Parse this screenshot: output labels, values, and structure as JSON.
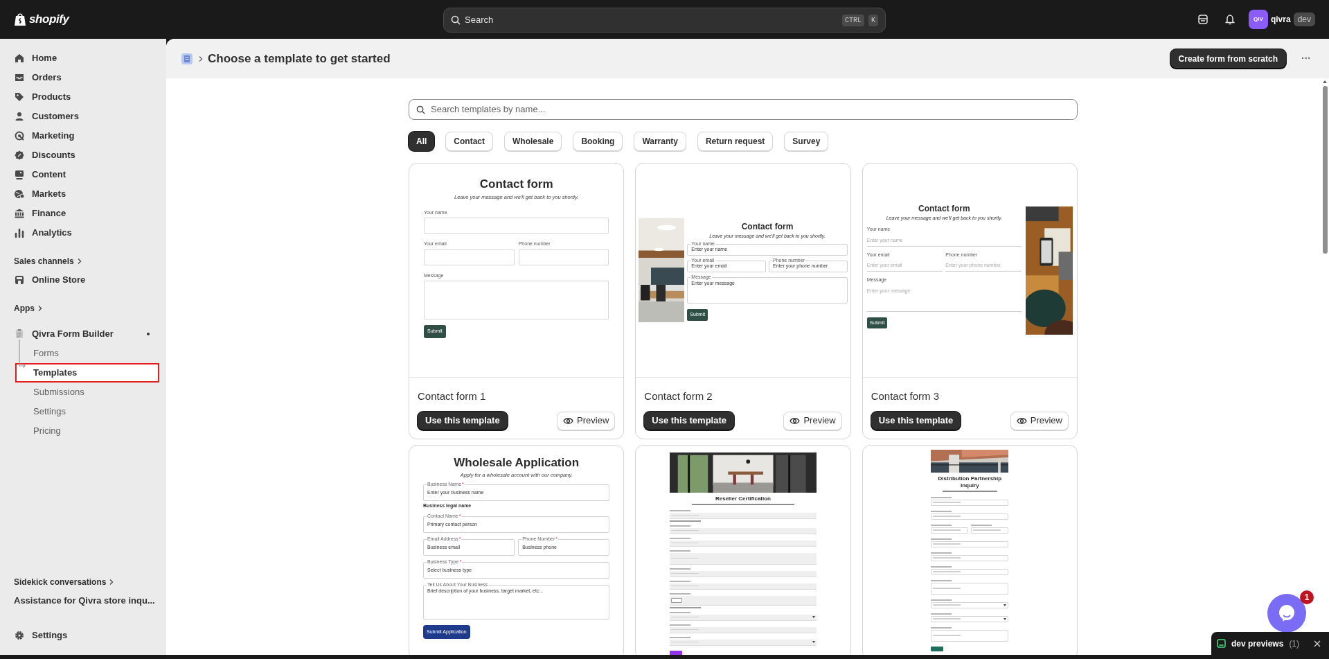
{
  "topbar": {
    "logo": "shopify",
    "search": {
      "placeholder": "Search",
      "keys": [
        "CTRL",
        "K"
      ]
    },
    "account": {
      "initials": "QIV",
      "store": "qivra",
      "badge": "dev"
    }
  },
  "sidebar": {
    "items": [
      {
        "label": "Home",
        "selected": false
      },
      {
        "label": "Orders",
        "selected": false
      },
      {
        "label": "Products",
        "selected": false
      },
      {
        "label": "Customers",
        "selected": false
      },
      {
        "label": "Marketing",
        "selected": false
      },
      {
        "label": "Discounts",
        "selected": false
      },
      {
        "label": "Content",
        "selected": false
      },
      {
        "label": "Markets",
        "selected": false
      },
      {
        "label": "Finance",
        "selected": false
      },
      {
        "label": "Analytics",
        "selected": false
      }
    ],
    "sales_channels": {
      "heading": "Sales channels",
      "items": [
        {
          "label": "Online Store",
          "selected": false
        }
      ]
    },
    "apps": {
      "heading": "Apps",
      "app": {
        "label": "Qivra Form Builder",
        "dot": true,
        "children": [
          {
            "label": "Forms",
            "selected": false
          },
          {
            "label": "Templates",
            "selected": true
          },
          {
            "label": "Submissions",
            "selected": false
          },
          {
            "label": "Settings",
            "selected": false
          },
          {
            "label": "Pricing",
            "selected": false
          }
        ]
      }
    },
    "sidekick": {
      "heading": "Sidekick conversations",
      "items": [
        "Assistance for Qivra store inqu..."
      ]
    },
    "footer_item": {
      "label": "Settings"
    }
  },
  "header": {
    "title": "Choose a template to get started",
    "primary_button": "Create form from scratch",
    "more": "···"
  },
  "search": {
    "placeholder": "Search templates by name..."
  },
  "filters": [
    {
      "label": "All",
      "selected": true
    },
    {
      "label": "Contact",
      "selected": false
    },
    {
      "label": "Wholesale",
      "selected": false
    },
    {
      "label": "Booking",
      "selected": false
    },
    {
      "label": "Warranty",
      "selected": false
    },
    {
      "label": "Return request",
      "selected": false
    },
    {
      "label": "Survey",
      "selected": false
    }
  ],
  "templates": [
    {
      "name": "Contact form 1",
      "use_button": "Use this template",
      "preview_button": "Preview",
      "preview": {
        "kind": "simple",
        "color": "#2f4f46",
        "title": "Contact form",
        "subtitle": "Leave your message and we'll get back to you shortly.",
        "rows": [
          [
            {
              "label": "Your name",
              "kind": "input"
            }
          ],
          [
            {
              "label": "Your email",
              "kind": "input"
            },
            {
              "label": "Phone number",
              "kind": "input"
            }
          ],
          [
            {
              "label": "Message",
              "kind": "textarea"
            }
          ]
        ],
        "submit": "Submit"
      }
    },
    {
      "name": "Contact form 2",
      "use_button": "Use this template",
      "preview_button": "Preview",
      "preview": {
        "kind": "photoleft",
        "color": "#2f4f46",
        "title": "Contact form",
        "subtitle": "Leave your message and we'll get back to you shortly.",
        "rows": [
          [
            {
              "label": "Your name",
              "placeholder": "Enter your name",
              "kind": "input"
            }
          ],
          [
            {
              "label": "Your email",
              "placeholder": "Enter your email",
              "kind": "input"
            },
            {
              "label": "Phone number",
              "placeholder": "Enter your phone number",
              "kind": "input"
            }
          ],
          [
            {
              "label": "Message",
              "placeholder": "Enter your message",
              "kind": "textarea"
            }
          ]
        ],
        "submit": "Submit"
      }
    },
    {
      "name": "Contact form 3",
      "use_button": "Use this template",
      "preview_button": "Preview",
      "preview": {
        "kind": "photoright",
        "color": "#2f4f46",
        "title": "Contact form",
        "subtitle": "Leave your message and we'll get back to you shortly.",
        "rows": [
          [
            {
              "label": "Your name",
              "placeholder": "Enter your name",
              "kind": "input"
            }
          ],
          [
            {
              "label": "Your email",
              "placeholder": "Enter your email",
              "kind": "input"
            },
            {
              "label": "Phone number",
              "placeholder": "Enter your phone number",
              "kind": "input"
            }
          ],
          [
            {
              "label": "Message",
              "placeholder": "Enter your message",
              "kind": "textarea"
            }
          ]
        ],
        "submit": "Submit"
      }
    },
    {
      "preview": {
        "kind": "outlined",
        "color": "#1e3a8a",
        "title": "Wholesale Application",
        "subtitle": "Apply for a wholesale account with our company.",
        "rows": [
          [
            {
              "label": "Business Name",
              "mark": "*",
              "placeholder": "Enter your business name",
              "kind": "input",
              "help": "Business legal name"
            }
          ],
          [
            {
              "label": "Contact Name",
              "mark": "*",
              "placeholder": "Primary contact person",
              "kind": "input"
            }
          ],
          [
            {
              "label": "Email Address",
              "mark": "*",
              "placeholder": "Business email",
              "kind": "input"
            },
            {
              "label": "Phone Number",
              "mark": "*",
              "placeholder": "Business phone",
              "kind": "input"
            }
          ],
          [
            {
              "label": "Business Type",
              "mark": "*",
              "placeholder": "Select business type",
              "kind": "input"
            }
          ],
          [
            {
              "label": "Tell Us About Your Business",
              "placeholder": "Brief description of your business, target market, etc...",
              "kind": "textarea"
            }
          ]
        ],
        "submit": "Submit Application"
      }
    },
    {
      "preview": {
        "kind": "banner",
        "color": "#9333ea",
        "title": "Reseller Certification",
        "fields": [
          {
            "kind": "input",
            "note": true
          },
          {
            "kind": "input",
            "note": false
          },
          {
            "kind": "input",
            "note": false
          },
          {
            "kind": "textarea",
            "note": false
          },
          {
            "kind": "input",
            "note": false
          },
          {
            "kind": "input",
            "note": false
          },
          {
            "kind": "file",
            "note": true
          },
          {
            "kind": "select",
            "note": false
          },
          {
            "kind": "input",
            "note": false
          },
          {
            "kind": "select",
            "note": false
          }
        ]
      }
    },
    {
      "preview": {
        "kind": "compact",
        "color": "#1f6f5f",
        "title": "Distribution Partnership Inquiry",
        "fields": [
          {
            "kind": "input",
            "note": false
          },
          {
            "kind": "input",
            "note": false
          },
          {
            "kind": "pair",
            "note": false
          },
          {
            "kind": "input",
            "note": false
          },
          {
            "kind": "input",
            "note": false
          },
          {
            "kind": "input",
            "note": false
          },
          {
            "kind": "textarea",
            "note": false
          },
          {
            "kind": "select",
            "note": false
          },
          {
            "kind": "select",
            "note": false
          },
          {
            "kind": "textarea",
            "note": false
          }
        ]
      }
    }
  ],
  "chat": {
    "badge": "1"
  },
  "dev_previews": {
    "label": "dev previews",
    "count": "(1)"
  }
}
